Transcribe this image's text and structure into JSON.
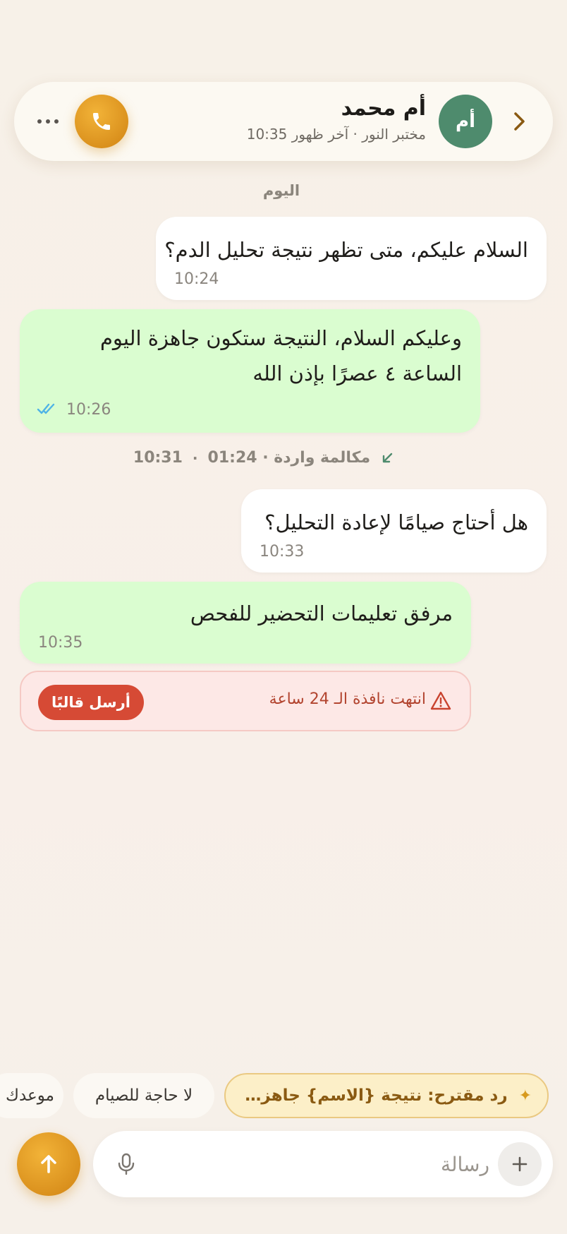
{
  "header": {
    "contact_name": "أم محمد",
    "contact_subtitle": "مختبر النور · آخر ظهور 10:35",
    "avatar_initials": "أم"
  },
  "day_label": "اليوم",
  "messages": [
    {
      "direction": "incoming",
      "text": "السلام عليكم، متى تظهر نتيجة تحليل الدم؟",
      "time": "10:24"
    },
    {
      "direction": "outgoing",
      "text": "وعليكم السلام، النتيجة ستكون جاهزة اليوم الساعة ٤ عصرًا بإذن الله",
      "time": "10:26",
      "status": "read"
    },
    {
      "direction": "incoming",
      "text": "هل أحتاج صيامًا لإعادة التحليل؟",
      "time": "10:33"
    },
    {
      "direction": "outgoing",
      "text": "مرفق تعليمات التحضير للفحص",
      "time": "10:35"
    }
  ],
  "call_event": {
    "label": "مكالمة واردة · 01:24",
    "time": "10:31"
  },
  "warning": {
    "text": "انتهت نافذة الـ 24 ساعة",
    "button_label": "أرسل قالبًا"
  },
  "suggestions": [
    {
      "label": "رد مقترح: نتيجة {الاسم} جاهزة اليوم..."
    },
    {
      "label": "لا حاجة للصيام"
    },
    {
      "label": "موعدك"
    }
  ],
  "composer": {
    "placeholder": "رسالة",
    "value": ""
  },
  "colors": {
    "accent": "#e09a22",
    "outgoing_bubble": "#dafdd0",
    "incoming_bubble": "#ffffff",
    "avatar": "#4e8b6d",
    "warning": "#d64a35",
    "read_ticks": "#4fb3e6"
  },
  "icons": {
    "back": "chevron-right-icon",
    "call": "phone-icon",
    "more": "more-horizontal-icon",
    "ticks": "double-check-icon",
    "incoming_call": "arrow-down-left-icon",
    "warning": "warning-triangle-icon",
    "sparkle": "sparkle-icon",
    "mic": "microphone-icon",
    "plus": "plus-icon",
    "send": "arrow-up-icon"
  }
}
